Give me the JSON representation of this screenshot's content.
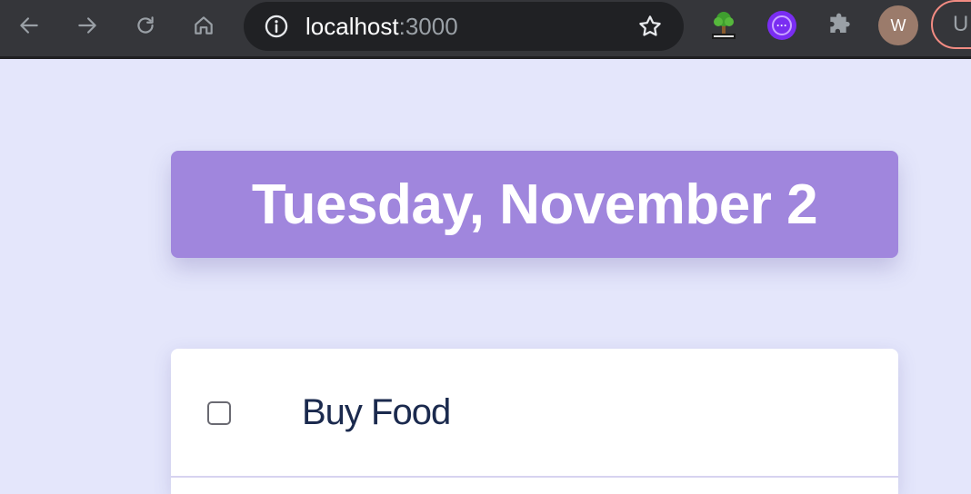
{
  "browser": {
    "url_host": "localhost",
    "url_port": ":3000",
    "avatar_initial": "W",
    "update_label": "U",
    "icons": {
      "back": "arrow-left-icon",
      "forward": "arrow-right-icon",
      "reload": "reload-icon",
      "home": "home-icon",
      "info": "info-icon",
      "bookmark": "star-icon",
      "extension_tree": "tree-html-extension-icon",
      "extension_purple": "purple-extension-icon",
      "extensions": "puzzle-icon"
    }
  },
  "app": {
    "date_heading": "Tuesday, November 2",
    "items": [
      {
        "text": "Buy Food",
        "checked": false
      }
    ]
  },
  "colors": {
    "page_bg": "#e4e6fb",
    "heading_bg": "#a086dd",
    "todo_text": "#1b2a4e"
  }
}
